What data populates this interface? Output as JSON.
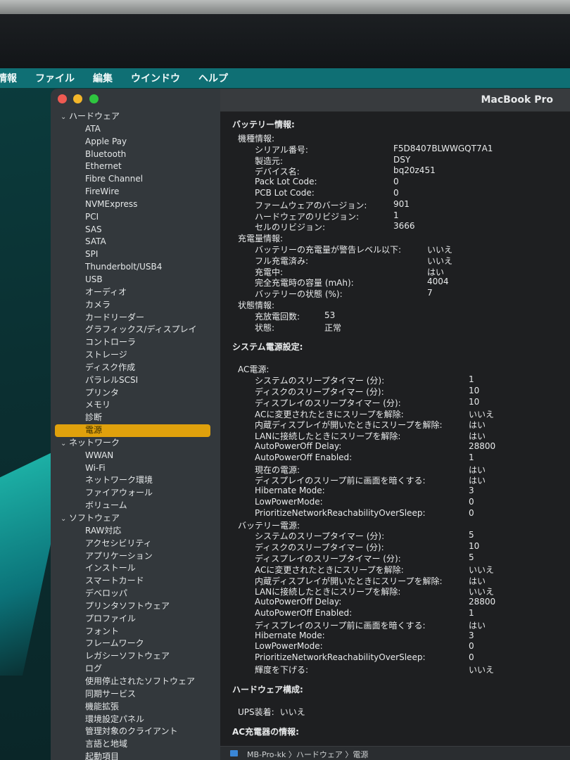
{
  "menubar": [
    "情報",
    "ファイル",
    "編集",
    "ウインドウ",
    "ヘルプ"
  ],
  "window": {
    "title": "MacBook Pro"
  },
  "sidebar": [
    {
      "label": "ハードウェア",
      "cat": true
    },
    {
      "label": "ATA"
    },
    {
      "label": "Apple Pay"
    },
    {
      "label": "Bluetooth"
    },
    {
      "label": "Ethernet"
    },
    {
      "label": "Fibre Channel"
    },
    {
      "label": "FireWire"
    },
    {
      "label": "NVMExpress"
    },
    {
      "label": "PCI"
    },
    {
      "label": "SAS"
    },
    {
      "label": "SATA"
    },
    {
      "label": "SPI"
    },
    {
      "label": "Thunderbolt/USB4"
    },
    {
      "label": "USB"
    },
    {
      "label": "オーディオ"
    },
    {
      "label": "カメラ"
    },
    {
      "label": "カードリーダー"
    },
    {
      "label": "グラフィックス/ディスプレイ"
    },
    {
      "label": "コントローラ"
    },
    {
      "label": "ストレージ"
    },
    {
      "label": "ディスク作成"
    },
    {
      "label": "パラレルSCSI"
    },
    {
      "label": "プリンタ"
    },
    {
      "label": "メモリ"
    },
    {
      "label": "診断"
    },
    {
      "label": "電源",
      "selected": true
    },
    {
      "label": "ネットワーク",
      "cat": true
    },
    {
      "label": "WWAN"
    },
    {
      "label": "Wi-Fi"
    },
    {
      "label": "ネットワーク環境"
    },
    {
      "label": "ファイアウォール"
    },
    {
      "label": "ボリューム"
    },
    {
      "label": "ソフトウェア",
      "cat": true
    },
    {
      "label": "RAW対応"
    },
    {
      "label": "アクセシビリティ"
    },
    {
      "label": "アプリケーション"
    },
    {
      "label": "インストール"
    },
    {
      "label": "スマートカード"
    },
    {
      "label": "デベロッパ"
    },
    {
      "label": "プリンタソフトウェア"
    },
    {
      "label": "プロファイル"
    },
    {
      "label": "フォント"
    },
    {
      "label": "フレームワーク"
    },
    {
      "label": "レガシーソフトウェア"
    },
    {
      "label": "ログ"
    },
    {
      "label": "使用停止されたソフトウェア"
    },
    {
      "label": "同期サービス"
    },
    {
      "label": "機能拡張"
    },
    {
      "label": "環境設定パネル"
    },
    {
      "label": "管理対象のクライアント"
    },
    {
      "label": "言語と地域"
    },
    {
      "label": "起動項目"
    }
  ],
  "content": [
    {
      "label": "バッテリー情報:",
      "lvl": 0,
      "bold": true
    },
    {
      "label": "機種情報:",
      "lvl": 1
    },
    {
      "label": "シリアル番号:",
      "value": "F5D8407BLWWGQT7A1",
      "lvl": 2,
      "v": "a"
    },
    {
      "label": "製造元:",
      "value": "DSY",
      "lvl": 2,
      "v": "a"
    },
    {
      "label": "デバイス名:",
      "value": "bq20z451",
      "lvl": 2,
      "v": "a"
    },
    {
      "label": "Pack Lot Code:",
      "value": "0",
      "lvl": 2,
      "v": "a"
    },
    {
      "label": "PCB Lot Code:",
      "value": "0",
      "lvl": 2,
      "v": "a"
    },
    {
      "label": "ファームウェアのバージョン:",
      "value": "901",
      "lvl": 2,
      "v": "a"
    },
    {
      "label": "ハードウェアのリビジョン:",
      "value": "1",
      "lvl": 2,
      "v": "a"
    },
    {
      "label": "セルのリビジョン:",
      "value": "3666",
      "lvl": 2,
      "v": "a"
    },
    {
      "label": "充電量情報:",
      "lvl": 1
    },
    {
      "label": "バッテリーの充電量が警告レベル以下:",
      "value": "いいえ",
      "lvl": 2,
      "v": "b"
    },
    {
      "label": "フル充電済み:",
      "value": "いいえ",
      "lvl": 2,
      "v": "b"
    },
    {
      "label": "充電中:",
      "value": "はい",
      "lvl": 2,
      "v": "b"
    },
    {
      "label": "完全充電時の容量 (mAh):",
      "value": "4004",
      "lvl": 2,
      "v": "b"
    },
    {
      "label": "バッテリーの状態 (%):",
      "value": "7",
      "lvl": 2,
      "v": "b"
    },
    {
      "label": "状態情報:",
      "lvl": 1
    },
    {
      "label": "充放電回数:",
      "value": "53",
      "lvl": 2,
      "v": "c"
    },
    {
      "label": "状態:",
      "value": "正常",
      "lvl": 2,
      "v": "c"
    },
    {
      "label": "システム電源設定:",
      "lvl": 0,
      "bold": true,
      "gap": true
    },
    {
      "label": "AC電源:",
      "lvl": 1,
      "gap": true
    },
    {
      "label": "システムのスリープタイマー (分):",
      "value": "1",
      "lvl": 2,
      "v": "d"
    },
    {
      "label": "ディスクのスリープタイマー (分):",
      "value": "10",
      "lvl": 2,
      "v": "d"
    },
    {
      "label": "ディスプレイのスリープタイマー (分):",
      "value": "10",
      "lvl": 2,
      "v": "d"
    },
    {
      "label": "ACに変更されたときにスリープを解除:",
      "value": "いいえ",
      "lvl": 2,
      "v": "d"
    },
    {
      "label": "内蔵ディスプレイが開いたときにスリープを解除:",
      "value": "はい",
      "lvl": 2,
      "v": "d"
    },
    {
      "label": "LANに接続したときにスリープを解除:",
      "value": "はい",
      "lvl": 2,
      "v": "d"
    },
    {
      "label": "AutoPowerOff Delay:",
      "value": "28800",
      "lvl": 2,
      "v": "d"
    },
    {
      "label": "AutoPowerOff Enabled:",
      "value": "1",
      "lvl": 2,
      "v": "d"
    },
    {
      "label": "現在の電源:",
      "value": "はい",
      "lvl": 2,
      "v": "d"
    },
    {
      "label": "ディスプレイのスリープ前に画面を暗くする:",
      "value": "はい",
      "lvl": 2,
      "v": "d"
    },
    {
      "label": "Hibernate Mode:",
      "value": "3",
      "lvl": 2,
      "v": "d"
    },
    {
      "label": "LowPowerMode:",
      "value": "0",
      "lvl": 2,
      "v": "d"
    },
    {
      "label": "PrioritizeNetworkReachabilityOverSleep:",
      "value": "0",
      "lvl": 2,
      "v": "d"
    },
    {
      "label": "バッテリー電源:",
      "lvl": 1
    },
    {
      "label": "システムのスリープタイマー (分):",
      "value": "5",
      "lvl": 2,
      "v": "d"
    },
    {
      "label": "ディスクのスリープタイマー (分):",
      "value": "10",
      "lvl": 2,
      "v": "d"
    },
    {
      "label": "ディスプレイのスリープタイマー (分):",
      "value": "5",
      "lvl": 2,
      "v": "d"
    },
    {
      "label": "ACに変更されたときにスリープを解除:",
      "value": "いいえ",
      "lvl": 2,
      "v": "d"
    },
    {
      "label": "内蔵ディスプレイが開いたときにスリープを解除:",
      "value": "はい",
      "lvl": 2,
      "v": "d"
    },
    {
      "label": "LANに接続したときにスリープを解除:",
      "value": "いいえ",
      "lvl": 2,
      "v": "d"
    },
    {
      "label": "AutoPowerOff Delay:",
      "value": "28800",
      "lvl": 2,
      "v": "d"
    },
    {
      "label": "AutoPowerOff Enabled:",
      "value": "1",
      "lvl": 2,
      "v": "d"
    },
    {
      "label": "ディスプレイのスリープ前に画面を暗くする:",
      "value": "はい",
      "lvl": 2,
      "v": "d"
    },
    {
      "label": "Hibernate Mode:",
      "value": "3",
      "lvl": 2,
      "v": "d"
    },
    {
      "label": "LowPowerMode:",
      "value": "0",
      "lvl": 2,
      "v": "d"
    },
    {
      "label": "PrioritizeNetworkReachabilityOverSleep:",
      "value": "0",
      "lvl": 2,
      "v": "d"
    },
    {
      "label": "輝度を下げる:",
      "value": "いいえ",
      "lvl": 2,
      "v": "d"
    },
    {
      "label": "ハードウェア構成:",
      "lvl": 0,
      "bold": true,
      "gap": true
    },
    {
      "label": "UPS装着:",
      "value": "いいえ",
      "lvl": 1,
      "v": "inline",
      "gap": true
    },
    {
      "label": "AC充電器の情報:",
      "lvl": 0,
      "bold": true,
      "gap": true
    }
  ],
  "statusbar": {
    "path": "MB-Pro-kk 〉ハードウェア 〉電源"
  }
}
